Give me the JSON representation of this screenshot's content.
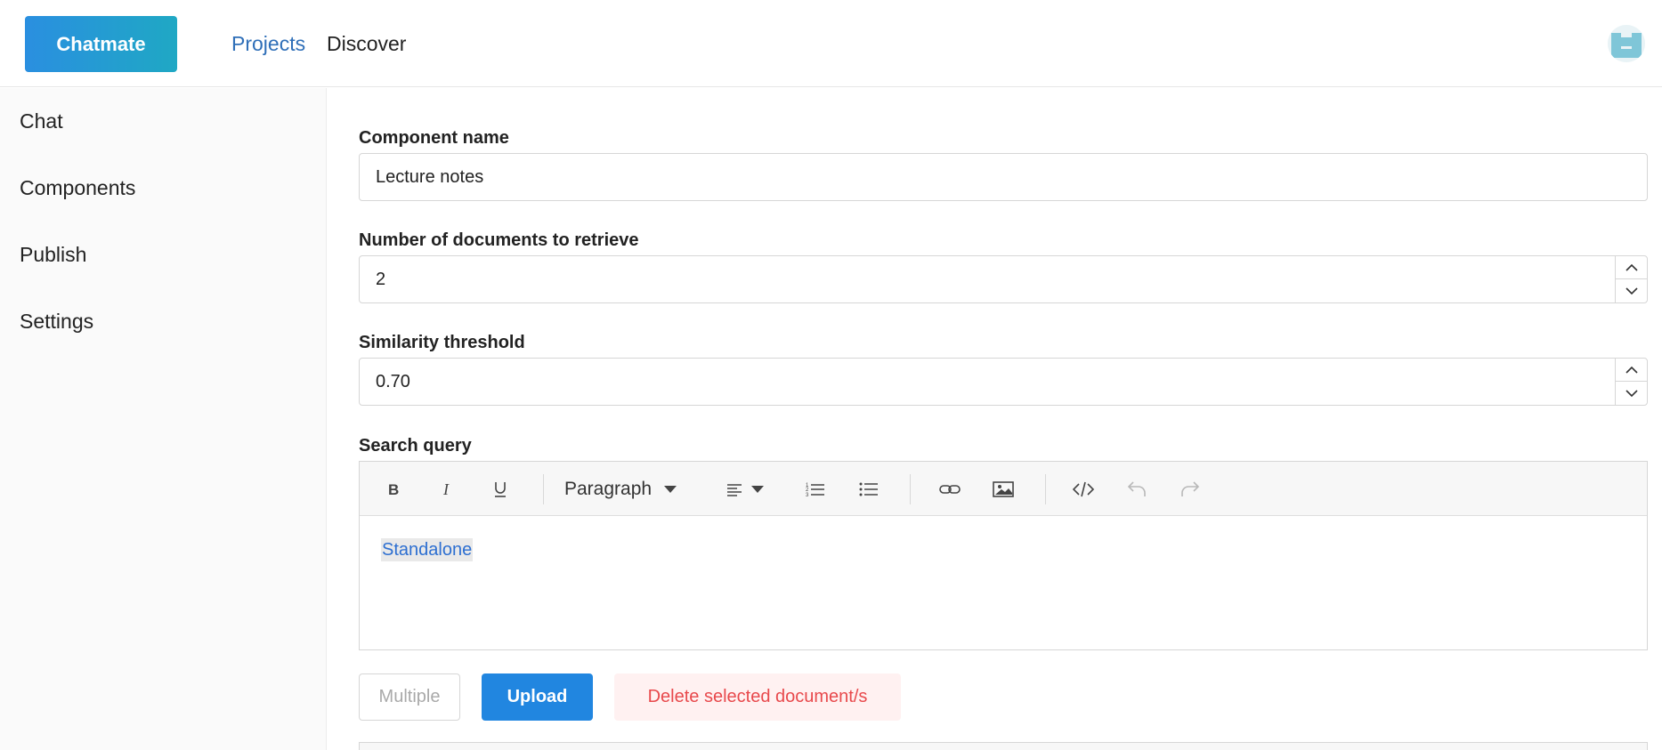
{
  "header": {
    "brand_label": "Chatmate",
    "nav": [
      {
        "label": "Projects",
        "active": true
      },
      {
        "label": "Discover",
        "active": false
      }
    ],
    "avatar_icon": "user-avatar-icon"
  },
  "sidebar": {
    "items": [
      {
        "label": "Chat"
      },
      {
        "label": "Components"
      },
      {
        "label": "Publish"
      },
      {
        "label": "Settings"
      }
    ]
  },
  "form": {
    "component_name": {
      "label": "Component name",
      "value": "Lecture notes"
    },
    "num_documents": {
      "label": "Number of documents to retrieve",
      "value": "2"
    },
    "similarity_threshold": {
      "label": "Similarity threshold",
      "value": "0.70"
    },
    "search_query": {
      "label": "Search query",
      "toolbar": {
        "bold_icon": "bold-icon",
        "italic_icon": "italic-icon",
        "underline_icon": "underline-icon",
        "block_format": "Paragraph",
        "align_icon": "align-left-icon",
        "ordered_list_icon": "ordered-list-icon",
        "bullet_list_icon": "bullet-list-icon",
        "link_icon": "link-icon",
        "image_icon": "image-icon",
        "code_icon": "code-icon",
        "undo_icon": "undo-icon",
        "redo_icon": "redo-icon"
      },
      "content_link": "Standalone"
    }
  },
  "actions": {
    "multiple_label": "Multiple",
    "upload_label": "Upload",
    "delete_label": "Delete selected document/s"
  },
  "colors": {
    "brand_gradient_start": "#2a8fe0",
    "brand_gradient_end": "#1fa8c4",
    "nav_active": "#2f6fb8",
    "upload_bg": "#2186e0",
    "delete_text": "#e8494c",
    "delete_bg": "#fff1f1",
    "link": "#2d6fd1"
  }
}
